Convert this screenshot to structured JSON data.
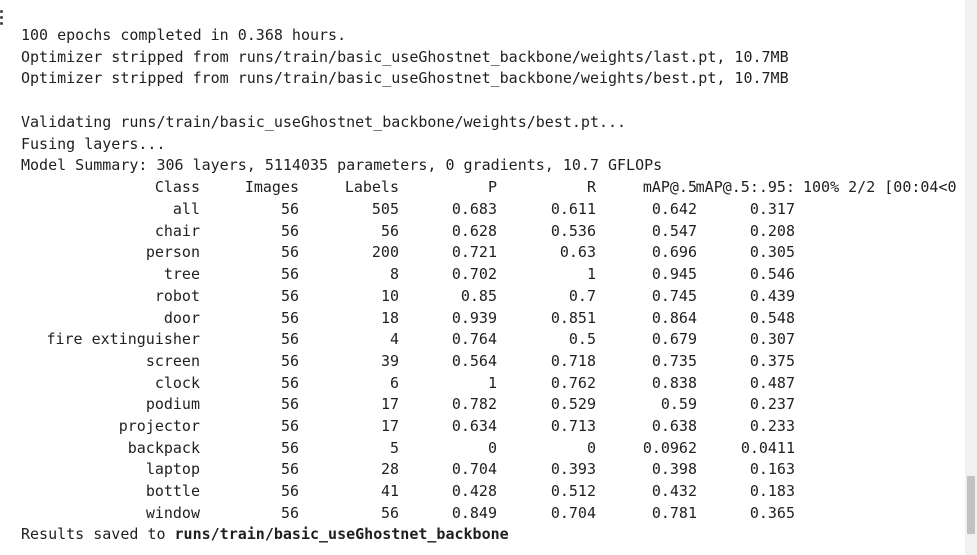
{
  "log_lines": [
    "100 epochs completed in 0.368 hours.",
    "Optimizer stripped from runs/train/basic_useGhostnet_backbone/weights/last.pt, 10.7MB",
    "Optimizer stripped from runs/train/basic_useGhostnet_backbone/weights/best.pt, 10.7MB",
    "",
    "Validating runs/train/basic_useGhostnet_backbone/weights/best.pt...",
    "Fusing layers...",
    "Model Summary: 306 layers, 5114035 parameters, 0 gradients, 10.7 GFLOPs"
  ],
  "table": {
    "headers": [
      "Class",
      "Images",
      "Labels",
      "P",
      "R",
      "mAP@.5",
      "mAP@.5:.95:"
    ],
    "progress_text": "100% 2/2 [00:04<0",
    "rows": [
      [
        "all",
        "56",
        "505",
        "0.683",
        "0.611",
        "0.642",
        "0.317"
      ],
      [
        "chair",
        "56",
        "56",
        "0.628",
        "0.536",
        "0.547",
        "0.208"
      ],
      [
        "person",
        "56",
        "200",
        "0.721",
        "0.63",
        "0.696",
        "0.305"
      ],
      [
        "tree",
        "56",
        "8",
        "0.702",
        "1",
        "0.945",
        "0.546"
      ],
      [
        "robot",
        "56",
        "10",
        "0.85",
        "0.7",
        "0.745",
        "0.439"
      ],
      [
        "door",
        "56",
        "18",
        "0.939",
        "0.851",
        "0.864",
        "0.548"
      ],
      [
        "fire extinguisher",
        "56",
        "4",
        "0.764",
        "0.5",
        "0.679",
        "0.307"
      ],
      [
        "screen",
        "56",
        "39",
        "0.564",
        "0.718",
        "0.735",
        "0.375"
      ],
      [
        "clock",
        "56",
        "6",
        "1",
        "0.762",
        "0.838",
        "0.487"
      ],
      [
        "podium",
        "56",
        "17",
        "0.782",
        "0.529",
        "0.59",
        "0.237"
      ],
      [
        "projector",
        "56",
        "17",
        "0.634",
        "0.713",
        "0.638",
        "0.233"
      ],
      [
        "backpack",
        "56",
        "5",
        "0",
        "0",
        "0.0962",
        "0.0411"
      ],
      [
        "laptop",
        "56",
        "28",
        "0.704",
        "0.393",
        "0.398",
        "0.163"
      ],
      [
        "bottle",
        "56",
        "41",
        "0.428",
        "0.512",
        "0.432",
        "0.183"
      ],
      [
        "window",
        "56",
        "56",
        "0.849",
        "0.704",
        "0.781",
        "0.365"
      ]
    ]
  },
  "results": {
    "prefix": "Results saved to ",
    "path": "runs/train/basic_useGhostnet_backbone"
  },
  "scrollbar": {
    "thumb_color": "#c1c1c1",
    "track_color": "#f1f1f1"
  }
}
